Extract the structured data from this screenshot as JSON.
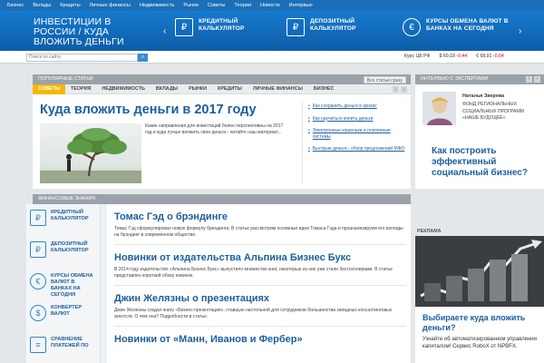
{
  "topnav": [
    "Бизнес",
    "Вклады",
    "Кредиты",
    "Личные финансы",
    "Недвижимость",
    "Рынки",
    "Советы",
    "Теория",
    "Новости",
    "Интервью"
  ],
  "hero": {
    "title": "ИНВЕСТИЦИИ В РОССИИ / КУДА ВЛОЖИТЬ ДЕНЬГИ",
    "items": [
      {
        "label": "КРЕДИТНЫЙ КАЛЬКУЛЯТОР",
        "icon": "calculator-icon",
        "glyph": "₽"
      },
      {
        "label": "ДЕПОЗИТНЫЙ КАЛЬКУЛЯТОР",
        "icon": "deposit-calculator-icon",
        "glyph": "₽"
      },
      {
        "label": "КУРСЫ ОБМЕНА ВАЛЮТ В БАНКАХ НА СЕГОДНЯ",
        "icon": "currency-exchange-icon",
        "glyph": "€"
      }
    ],
    "prev_arrow": "‹",
    "next_arrow": "›"
  },
  "search": {
    "placeholder": "Поиск по сайту"
  },
  "rates": {
    "label": "Курс ЦБ РФ",
    "usd": {
      "symbol": "$",
      "value": "60,18",
      "change": "-0,44"
    },
    "eur": {
      "symbol": "€",
      "value": "68,91",
      "change": "-0,64"
    }
  },
  "popular": {
    "header": "ПОПУЛЯРНЫЕ СТАТЬИ",
    "all_button": "Все статьи сразу",
    "tabs": [
      "СОВЕТЫ",
      "ТЕОРИЯ",
      "НЕДВИЖИМОСТЬ",
      "ВКЛАДЫ",
      "РЫНКИ",
      "КРЕДИТЫ",
      "ЛИЧНЫЕ ФИНАНСЫ",
      "БИЗНЕС"
    ],
    "featured": {
      "title": "Куда вложить деньги в 2017 году",
      "text": "Какие направления для инвестиций более перспективны на 2017 год и куда лучше вложить свои деньги - читайте наш материал...",
      "links": [
        "Как сохранить деньги в кризис",
        "Как научиться копить деньги",
        "Электронные кошельки и платежные системы",
        "Быстрые деньги - обзор предложений МФО"
      ]
    }
  },
  "finance": {
    "header": "ФИНАНСОВЫЕ ЗНАНИЯ",
    "articles": [
      {
        "title": "Томас Гэд о брэндинге",
        "text": "Томас Гэд сформулировал новую формулу брендинга. В статье рассмотрим основные идеи Томаса Гэда и проанализируем его взгляды на брэндинг в современном обществе."
      },
      {
        "title": "Новинки от издательства Альпина Бизнес Букс",
        "text": "В 2014 году издательство «Альпина Бизнес Букс» выпустило множество книг, некоторые из них уже стали бестселлерами. В статье представлен короткий обзор новинок."
      },
      {
        "title": "Джин Желязны о презентациях",
        "text": "Джин Желязны создал книгу «Бизнес-презентация», ставшую настольной для сотрудников большинства западных консалтинговых агентств. О чем она? Подробности в статье."
      },
      {
        "title": "Новинки от «Манн, Иванов и Фербер»",
        "text": ""
      }
    ]
  },
  "sidebar": [
    {
      "label": "КРЕДИТНЫЙ КАЛЬКУЛЯТОР",
      "icon": "calculator-icon",
      "glyph": "₽"
    },
    {
      "label": "ДЕПОЗИТНЫЙ КАЛЬКУЛЯТОР",
      "icon": "deposit-calculator-icon",
      "glyph": "₽"
    },
    {
      "label": "КУРСЫ ОБМЕНА ВАЛЮТ В БАНКАХ НА СЕГОДНЯ",
      "icon": "currency-exchange-icon",
      "glyph": "€"
    },
    {
      "label": "КОНВЕРТЕР ВАЛЮТ",
      "icon": "currency-converter-icon",
      "glyph": "$"
    },
    {
      "label": "СРАВНЕНИЕ ПЛАТЕЖЕЙ ПО",
      "icon": "payment-comparison-icon",
      "glyph": "≡"
    }
  ],
  "experts": {
    "header": "ИНТЕРВЬЮ С ЭКСПЕРТАМИ",
    "name": "Наталья Зверева",
    "org": "ФОНД РЕГИОНАЛЬНЫХ СОЦИАЛЬНЫХ ПРОГРАММ «НАШЕ БУДУЩЕЕ»",
    "quote": "Как построить эффективный социальный бизнес?"
  },
  "ad": {
    "header": "РЕКЛАМА",
    "title": "Выбираете куда вложить деньги?",
    "text": "Узнайте об автоматизированном управлении капиталом! Сервис RoboX от NPBFX."
  },
  "colors": {
    "brand": "#1b6fb8",
    "link": "#1b5e9e",
    "accent": "#f5b800",
    "negative": "#d0021b"
  }
}
